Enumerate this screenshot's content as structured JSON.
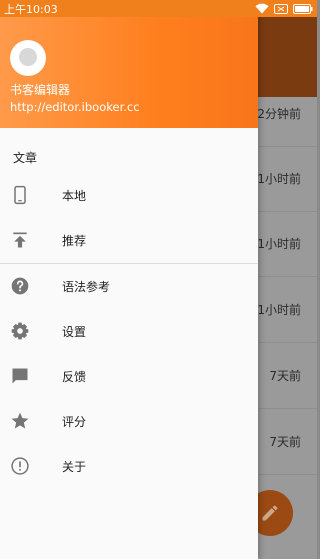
{
  "status_bar": {
    "time": "上午10:03"
  },
  "background_list": {
    "times": [
      "2分钟前",
      "1小时前",
      "1小时前",
      "1小时前",
      "7天前",
      "7天前"
    ]
  },
  "drawer": {
    "app_name": "书客编辑器",
    "app_url": "http://editor.ibooker.cc",
    "section_title": "文章",
    "items": [
      {
        "label": "本地",
        "icon": "phone-icon"
      },
      {
        "label": "推荐",
        "icon": "upload-icon"
      },
      {
        "label": "语法参考",
        "icon": "help-icon"
      },
      {
        "label": "设置",
        "icon": "gear-icon"
      },
      {
        "label": "反馈",
        "icon": "feedback-icon"
      },
      {
        "label": "评分",
        "icon": "star-icon"
      },
      {
        "label": "关于",
        "icon": "info-icon"
      }
    ]
  },
  "colors": {
    "accent": "#ff7f1e",
    "toolbar_dim": "#7a3b10",
    "icon": "#757575"
  }
}
